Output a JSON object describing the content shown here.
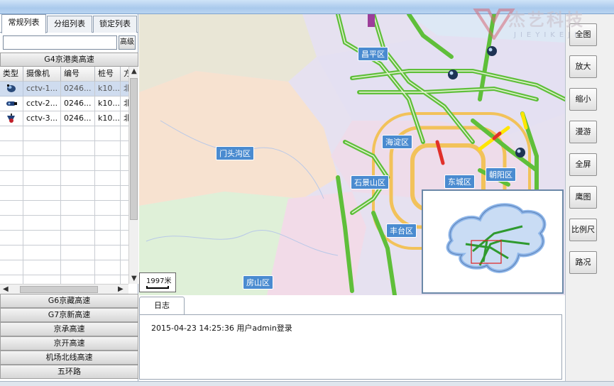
{
  "tabs": [
    "常规列表",
    "分组列表",
    "锁定列表"
  ],
  "search": {
    "placeholder": "",
    "advanced_label": "高级"
  },
  "active_group": "G4京港奥高速",
  "table": {
    "columns": [
      "类型",
      "摄像机",
      "编号",
      "桩号",
      "方"
    ],
    "rows": [
      {
        "type_icon": "dome-camera-icon",
        "camera": "cctv-1...",
        "code": "0246...",
        "stake": "k10...",
        "dir": "北"
      },
      {
        "type_icon": "bullet-camera-icon",
        "camera": "cctv-2...",
        "code": "0246...",
        "stake": "k10...",
        "dir": "北"
      },
      {
        "type_icon": "ptz-camera-icon",
        "camera": "cctv-3...",
        "code": "0246...",
        "stake": "k10...",
        "dir": "北"
      }
    ]
  },
  "groups": [
    "G6京藏高速",
    "G7京新高速",
    "京承高速",
    "京开高速",
    "机场北线高速",
    "五环路"
  ],
  "map": {
    "districts": [
      "昌平区",
      "海淀区",
      "门头沟区",
      "石景山区",
      "东城区",
      "朝阳区",
      "丰台区",
      "房山区"
    ],
    "scale_label": "1997米"
  },
  "toolbar": [
    "全图",
    "放大",
    "缩小",
    "漫游",
    "全屏",
    "鹰图",
    "比例尺",
    "路况"
  ],
  "log": {
    "tab_label": "日志",
    "entries": [
      "2015-04-23  14:25:36   用户admin登录"
    ]
  },
  "watermark": {
    "cn": "杰艺科技",
    "en": "JIEYIKEJI"
  }
}
